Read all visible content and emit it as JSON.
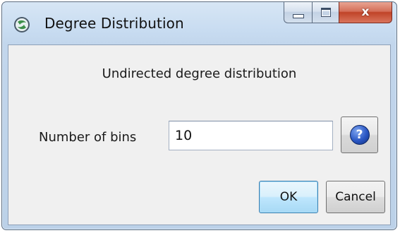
{
  "window": {
    "title": "Degree Distribution",
    "app_icon": "cytoscape-app-icon",
    "caption_buttons": {
      "minimize_icon": "minimize-icon",
      "maximize_icon": "maximize-icon",
      "close_label": "x"
    }
  },
  "dialog": {
    "heading": "Undirected degree distribution",
    "bins_label": "Number of bins",
    "bins_value": "10",
    "help_glyph": "?",
    "help_icon": "help-icon",
    "ok_label": "OK",
    "cancel_label": "Cancel"
  },
  "colors": {
    "title_bar": "#c8dcf1",
    "client_background": "#f0f0f0",
    "close_button": "#c04428",
    "default_button_border": "#3c7fb1",
    "help_icon": "#2a57c4"
  }
}
